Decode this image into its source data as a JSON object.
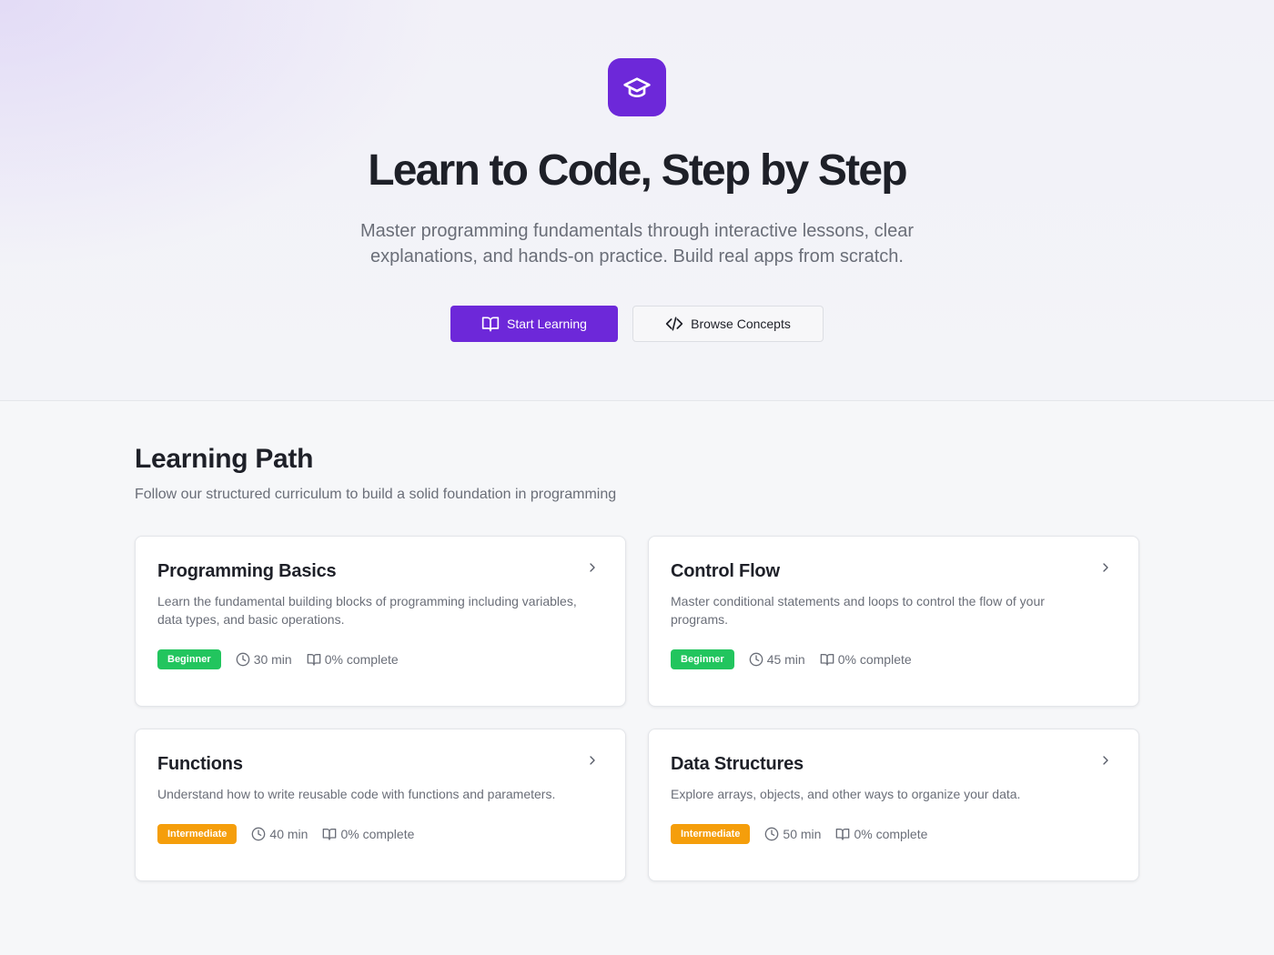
{
  "hero": {
    "title": "Learn to Code, Step by Step",
    "subtitle": "Master programming fundamentals through interactive lessons, clear explanations, and hands-on practice. Build real apps from scratch.",
    "primary_button": "Start Learning",
    "secondary_button": "Browse Concepts",
    "logo_icon": "graduation-cap-icon"
  },
  "learning_path": {
    "title": "Learning Path",
    "subtitle": "Follow our structured curriculum to build a solid foundation in programming",
    "modules": [
      {
        "title": "Programming Basics",
        "description": "Learn the fundamental building blocks of programming including variables, data types, and basic operations.",
        "level": "Beginner",
        "duration": "30 min",
        "progress": "0% complete"
      },
      {
        "title": "Control Flow",
        "description": "Master conditional statements and loops to control the flow of your programs.",
        "level": "Beginner",
        "duration": "45 min",
        "progress": "0% complete"
      },
      {
        "title": "Functions",
        "description": "Understand how to write reusable code with functions and parameters.",
        "level": "Intermediate",
        "duration": "40 min",
        "progress": "0% complete"
      },
      {
        "title": "Data Structures",
        "description": "Explore arrays, objects, and other ways to organize your data.",
        "level": "Intermediate",
        "duration": "50 min",
        "progress": "0% complete"
      }
    ]
  },
  "colors": {
    "accent": "#6d28d9",
    "beginner": "#22c55e",
    "intermediate": "#f59e0b"
  }
}
